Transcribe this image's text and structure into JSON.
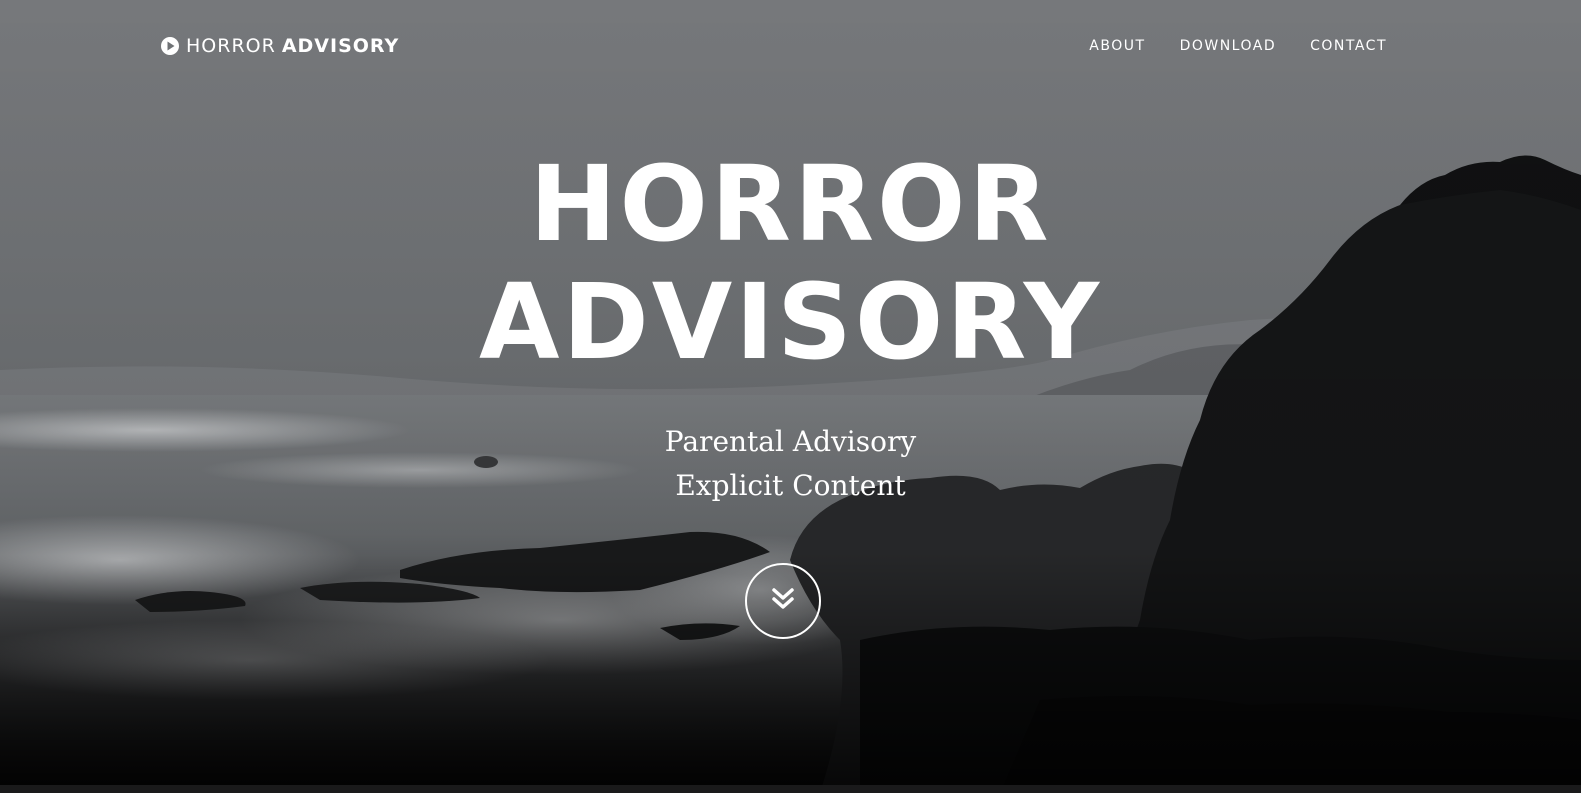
{
  "brand": {
    "icon": "play-circle-icon",
    "name_light": "HORROR",
    "name_bold": "ADVISORY"
  },
  "nav": {
    "items": [
      {
        "label": "ABOUT"
      },
      {
        "label": "DOWNLOAD"
      },
      {
        "label": "CONTACT"
      }
    ]
  },
  "hero": {
    "title_line1": "HORROR",
    "title_line2": "ADVISORY",
    "subtitle_line1": "Parental Advisory",
    "subtitle_line2": "Explicit Content",
    "scroll_icon": "double-chevron-down-icon"
  },
  "colors": {
    "text": "#ffffff",
    "sky": "#7b7d80",
    "cliff": "#141516"
  }
}
